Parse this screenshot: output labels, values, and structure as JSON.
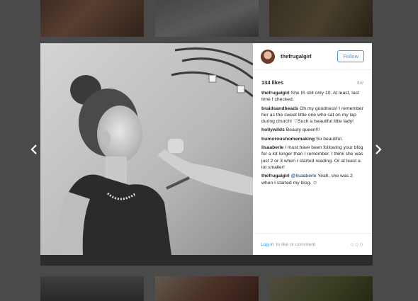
{
  "post": {
    "username": "thefrugalgirl",
    "follow_label": "Follow",
    "likes": "134 likes",
    "age": "4w"
  },
  "comments": [
    {
      "user": "thefrugalgirl",
      "text": " She IS still only 10. At least, last time I checked."
    },
    {
      "user": "braidsandbeads",
      "text": " Oh my goodness! I remember her as the sweet little one who sat on my lap during church! ♡Such a beautiful little lady!"
    },
    {
      "user": "hollywilds",
      "text": " Beauty queen!!!"
    },
    {
      "user": "humoroushomemaking",
      "text": " So beautiful."
    },
    {
      "user": "lisaaberle",
      "text": " I must have been following your blog for a lot longer than I remember. I think she was just 2 or 3 when I started reading. Or at least a lot smaller!"
    },
    {
      "user": "thefrugalgirl",
      "mention": "@lisaaberle",
      "text": " Yeah, she was 2 when I started my blog. ☺"
    }
  ],
  "footer": {
    "login_label": "Log in",
    "login_suffix": "to like or comment.",
    "more_label": "○○○"
  },
  "icons": {
    "prev": "chevron-left-icon",
    "next": "chevron-right-icon"
  }
}
